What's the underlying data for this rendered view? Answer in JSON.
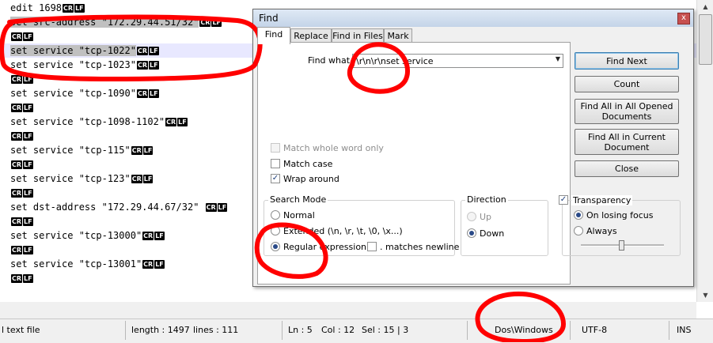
{
  "editor": {
    "lines": [
      {
        "text": "edit 1698",
        "eol": [
          "CR",
          "LF"
        ]
      },
      {
        "text": "set src-address \"172.29.44.51/32\"",
        "eol": [
          "CR",
          "LF"
        ]
      },
      {
        "text": "",
        "eol": [
          "CR",
          "LF"
        ]
      },
      {
        "text": "set service \"tcp-1022\"",
        "eol": [
          "CR",
          "LF"
        ]
      },
      {
        "text": "set service \"tcp-1023\"",
        "eol": [
          "CR",
          "LF"
        ]
      },
      {
        "text": "",
        "eol": [
          "CR",
          "LF"
        ]
      },
      {
        "text": "set service \"tcp-1090\"",
        "eol": [
          "CR",
          "LF"
        ]
      },
      {
        "text": "",
        "eol": [
          "CR",
          "LF"
        ]
      },
      {
        "text": "set service \"tcp-1098-1102\"",
        "eol": [
          "CR",
          "LF"
        ]
      },
      {
        "text": "",
        "eol": [
          "CR",
          "LF"
        ]
      },
      {
        "text": "set service \"tcp-115\"",
        "eol": [
          "CR",
          "LF"
        ]
      },
      {
        "text": "",
        "eol": [
          "CR",
          "LF"
        ]
      },
      {
        "text": "set service \"tcp-123\"",
        "eol": [
          "CR",
          "LF"
        ]
      },
      {
        "text": "",
        "eol": [
          "CR",
          "LF"
        ]
      },
      {
        "text": "set dst-address \"172.29.44.67/32\" ",
        "eol": [
          "CR",
          "LF"
        ]
      },
      {
        "text": "",
        "eol": [
          "CR",
          "LF"
        ]
      },
      {
        "text": "set service \"tcp-13000\"",
        "eol": [
          "CR",
          "LF"
        ]
      },
      {
        "text": "",
        "eol": [
          "CR",
          "LF"
        ]
      },
      {
        "text": "set service \"tcp-13001\"",
        "eol": [
          "CR",
          "LF"
        ]
      },
      {
        "text": "",
        "eol": [
          "CR",
          "LF"
        ]
      }
    ]
  },
  "statusbar": {
    "filetype": "l text file",
    "length": "length : 1497",
    "lines": "lines : 111",
    "ln": "Ln : 5",
    "col": "Col : 12",
    "sel": "Sel : 15 | 3",
    "eol_format": "Dos\\Windows",
    "encoding": "UTF-8",
    "mode": "INS"
  },
  "find": {
    "title": "Find",
    "close": "x",
    "tabs": [
      "Find",
      "Replace",
      "Find in Files",
      "Mark"
    ],
    "find_what_label": "Find what :",
    "find_what_value": "\\r\\n\\r\\nset service",
    "buttons": {
      "find_next": "Find Next",
      "count": "Count",
      "find_all_opened": "Find All in All Opened Documents",
      "find_all_current": "Find All in Current Document",
      "close": "Close"
    },
    "options": {
      "match_whole_word": "Match whole word only",
      "match_case": "Match case",
      "wrap_around": "Wrap around"
    },
    "search_mode": {
      "title": "Search Mode",
      "normal": "Normal",
      "extended": "Extended (\\n, \\r, \\t, \\0, \\x...)",
      "regex": "Regular expression",
      "dot_newline": ". matches newline"
    },
    "direction": {
      "title": "Direction",
      "up": "Up",
      "down": "Down"
    },
    "transparency": {
      "title": "Transparency",
      "on_losing_focus": "On losing focus",
      "always": "Always",
      "level": 0.5
    }
  },
  "colors": {
    "annotation": "#ff0000",
    "current_line": "#e8e8ff",
    "selection": "#c0c0c0",
    "eol_badge": "#000000"
  },
  "icons": {
    "scroll_up": "arrow-up-icon",
    "scroll_down": "arrow-down-icon",
    "close": "close-icon",
    "dropdown": "chevron-down-icon"
  }
}
